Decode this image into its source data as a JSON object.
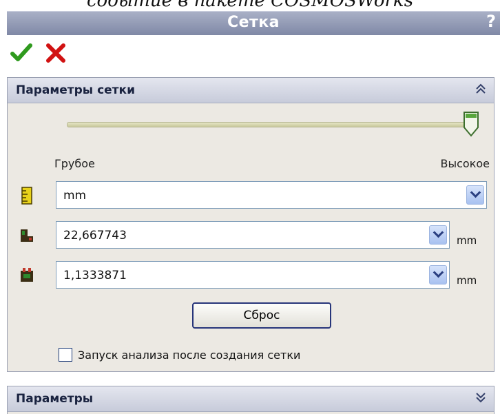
{
  "caption": "событие в пакете COSMOSWorks",
  "window": {
    "title": "Сетка",
    "help": "?"
  },
  "section_mesh": {
    "title": "Параметры сетки",
    "slider": {
      "min_label": "Грубое",
      "max_label": "Высокое",
      "value_fraction": 1.0
    },
    "units_select": {
      "value": "mm"
    },
    "global_size": {
      "value": "22,667743",
      "unit": "mm"
    },
    "tolerance": {
      "value": "1,1333871",
      "unit": "mm"
    },
    "reset_label": "Сброс",
    "run_analysis": {
      "label": "Запуск анализа после создания сетки",
      "checked": false
    }
  },
  "section_params": {
    "title": "Параметры"
  },
  "colors": {
    "ok": "#2f9a1e",
    "cancel": "#d11212",
    "titlebar": "#8a92ae"
  },
  "icons": [
    "check-icon",
    "close-icon",
    "collapse-up-icon",
    "expand-down-icon",
    "ruler-icon",
    "element-size-icon",
    "tolerance-icon"
  ]
}
